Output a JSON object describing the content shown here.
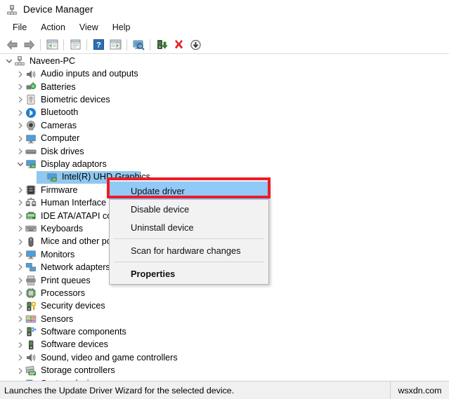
{
  "window": {
    "title": "Device Manager",
    "title_icon": "device-manager-icon"
  },
  "menubar": {
    "items": [
      {
        "label": "File",
        "name": "menu-file"
      },
      {
        "label": "Action",
        "name": "menu-action"
      },
      {
        "label": "View",
        "name": "menu-view"
      },
      {
        "label": "Help",
        "name": "menu-help"
      }
    ]
  },
  "toolbar": {
    "buttons": [
      {
        "icon": "back-arrow-icon",
        "name": "toolbar-back"
      },
      {
        "icon": "forward-arrow-icon",
        "name": "toolbar-forward"
      },
      {
        "icon": "show-hide-console-tree-icon",
        "name": "toolbar-console-tree"
      },
      {
        "icon": "properties-window-icon",
        "name": "toolbar-properties"
      },
      {
        "icon": "help-icon",
        "name": "toolbar-help"
      },
      {
        "icon": "show-hide-action-pane-icon",
        "name": "toolbar-action-pane"
      },
      {
        "icon": "scan-hardware-changes-icon",
        "name": "toolbar-scan-hardware"
      },
      {
        "icon": "update-driver-icon",
        "name": "toolbar-update-driver"
      },
      {
        "icon": "uninstall-device-icon",
        "name": "toolbar-uninstall-device"
      },
      {
        "icon": "disable-device-icon",
        "name": "toolbar-disable-device"
      }
    ]
  },
  "tree": {
    "nodes": [
      {
        "label": "Naveen-PC",
        "depth": 0,
        "expanded": true,
        "icon": "computer-root-icon",
        "selected": false
      },
      {
        "label": "Audio inputs and outputs",
        "depth": 1,
        "expanded": false,
        "icon": "audio-icon",
        "selected": false
      },
      {
        "label": "Batteries",
        "depth": 1,
        "expanded": false,
        "icon": "battery-icon",
        "selected": false
      },
      {
        "label": "Biometric devices",
        "depth": 1,
        "expanded": false,
        "icon": "fingerprint-icon",
        "selected": false
      },
      {
        "label": "Bluetooth",
        "depth": 1,
        "expanded": false,
        "icon": "bluetooth-icon",
        "selected": false
      },
      {
        "label": "Cameras",
        "depth": 1,
        "expanded": false,
        "icon": "camera-icon",
        "selected": false
      },
      {
        "label": "Computer",
        "depth": 1,
        "expanded": false,
        "icon": "monitor-icon",
        "selected": false
      },
      {
        "label": "Disk drives",
        "depth": 1,
        "expanded": false,
        "icon": "disk-drive-icon",
        "selected": false
      },
      {
        "label": "Display adaptors",
        "depth": 1,
        "expanded": true,
        "icon": "display-adapter-icon",
        "selected": false
      },
      {
        "label": "Intel(R) UHD Graphics",
        "depth": 2,
        "expanded": null,
        "icon": "display-adapter-icon",
        "selected": true
      },
      {
        "label": "Firmware",
        "depth": 1,
        "expanded": false,
        "icon": "firmware-icon",
        "selected": false
      },
      {
        "label": "Human Interface Devices",
        "depth": 1,
        "expanded": false,
        "icon": "hid-icon",
        "selected": false
      },
      {
        "label": "IDE ATA/ATAPI controllers",
        "depth": 1,
        "expanded": false,
        "icon": "ide-controller-icon",
        "selected": false
      },
      {
        "label": "Keyboards",
        "depth": 1,
        "expanded": false,
        "icon": "keyboard-icon",
        "selected": false
      },
      {
        "label": "Mice and other pointing devices",
        "depth": 1,
        "expanded": false,
        "icon": "mouse-icon",
        "selected": false
      },
      {
        "label": "Monitors",
        "depth": 1,
        "expanded": false,
        "icon": "monitor-icon",
        "selected": false
      },
      {
        "label": "Network adapters",
        "depth": 1,
        "expanded": false,
        "icon": "network-adapter-icon",
        "selected": false
      },
      {
        "label": "Print queues",
        "depth": 1,
        "expanded": false,
        "icon": "printer-icon",
        "selected": false
      },
      {
        "label": "Processors",
        "depth": 1,
        "expanded": false,
        "icon": "processor-icon",
        "selected": false
      },
      {
        "label": "Security devices",
        "depth": 1,
        "expanded": false,
        "icon": "security-key-icon",
        "selected": false
      },
      {
        "label": "Sensors",
        "depth": 1,
        "expanded": false,
        "icon": "sensors-icon",
        "selected": false
      },
      {
        "label": "Software components",
        "depth": 1,
        "expanded": false,
        "icon": "software-component-icon",
        "selected": false
      },
      {
        "label": "Software devices",
        "depth": 1,
        "expanded": false,
        "icon": "software-device-icon",
        "selected": false
      },
      {
        "label": "Sound, video and game controllers",
        "depth": 1,
        "expanded": false,
        "icon": "sound-icon",
        "selected": false
      },
      {
        "label": "Storage controllers",
        "depth": 1,
        "expanded": false,
        "icon": "storage-controller-icon",
        "selected": false
      },
      {
        "label": "System devices",
        "depth": 1,
        "expanded": false,
        "icon": "system-device-icon",
        "selected": false
      }
    ]
  },
  "context_menu": {
    "items": [
      {
        "label": "Update driver",
        "highlighted": true,
        "bold": false,
        "name": "ctx-update-driver"
      },
      {
        "label": "Disable device",
        "highlighted": false,
        "bold": false,
        "name": "ctx-disable-device"
      },
      {
        "label": "Uninstall device",
        "highlighted": false,
        "bold": false,
        "name": "ctx-uninstall-device"
      },
      {
        "separator": true
      },
      {
        "label": "Scan for hardware changes",
        "highlighted": false,
        "bold": false,
        "name": "ctx-scan-hardware-changes"
      },
      {
        "separator": true
      },
      {
        "label": "Properties",
        "highlighted": false,
        "bold": true,
        "name": "ctx-properties"
      }
    ]
  },
  "annotation": {
    "color": "#ee1c25",
    "target": "Update driver"
  },
  "statusbar": {
    "text": "Launches the Update Driver Wizard for the selected device.",
    "watermark": "wsxdn.com"
  },
  "colors": {
    "selection_blue": "#90c8f0",
    "menu_highlight": "#91c9f7",
    "annotation_red": "#ee1c25",
    "window_bg": "#ffffff",
    "statusbar_bg": "#f0f0f0"
  }
}
